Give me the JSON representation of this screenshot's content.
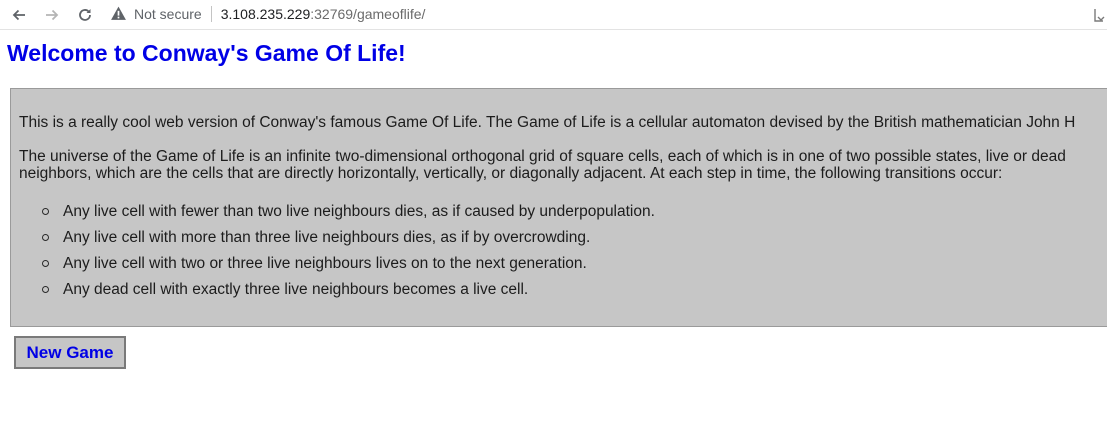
{
  "browser": {
    "security_label": "Not secure",
    "url_host": "3.108.235.229",
    "url_rest": ":32769/gameoflife/",
    "icons": [
      "back-arrow-icon",
      "forward-arrow-icon",
      "reload-icon",
      "warning-icon",
      "tab-search-icon"
    ]
  },
  "page": {
    "title": "Welcome to Conway's Game Of Life!",
    "intro": "This is a really cool web version of Conway's famous Game Of Life. The Game of Life is a cellular automaton devised by the British mathematician John H",
    "universe_line1": "The universe of the Game of Life is an infinite two-dimensional orthogonal grid of square cells, each of which is in one of two possible states, live or dead",
    "universe_line2": "neighbors, which are the cells that are directly horizontally, vertically, or diagonally adjacent. At each step in time, the following transitions occur:",
    "rules": [
      "Any live cell with fewer than two live neighbours dies, as if caused by underpopulation.",
      "Any live cell with more than three live neighbours dies, as if by overcrowding.",
      "Any live cell with two or three live neighbours lives on to the next generation.",
      "Any dead cell with exactly three live neighbours becomes a live cell."
    ],
    "new_game_label": "New Game"
  },
  "colors": {
    "title": "#0000e6",
    "box_background": "#c6c6c6",
    "button_text": "#0000e6"
  }
}
